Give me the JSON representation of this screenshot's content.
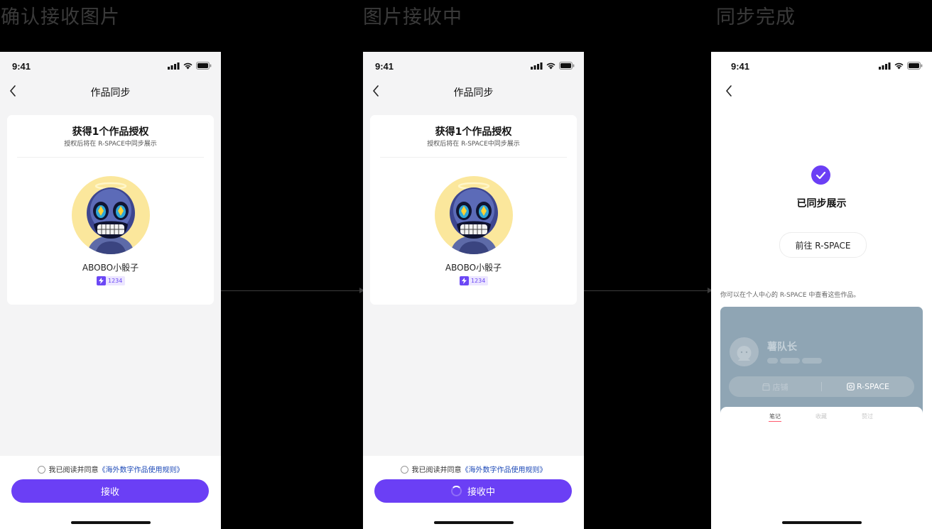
{
  "flow": {
    "step1_title": "确认接收图片",
    "step2_title": "图片接收中",
    "step3_title": "同步完成"
  },
  "status_bar": {
    "time": "9:41"
  },
  "screen_receive": {
    "nav_title": "作品同步",
    "card_title": "获得1个作品授权",
    "card_subtitle": "授权后将在 R-SPACE中同步展示",
    "artwork_name": "ABOBO小骰子",
    "artwork_number": "1234",
    "agree_prefix": "我已阅读并同意",
    "agree_link": "《海外数字作品使用规则》",
    "button_label": "接收"
  },
  "screen_receiving": {
    "nav_title": "作品同步",
    "card_title": "获得1个作品授权",
    "card_subtitle": "授权后将在 R-SPACE中同步展示",
    "artwork_name": "ABOBO小骰子",
    "artwork_number": "1234",
    "agree_prefix": "我已阅读并同意",
    "agree_link": "《海外数字作品使用规则》",
    "button_label": "接收中"
  },
  "screen_done": {
    "done_text": "已同步展示",
    "goto_button": "前往 R-SPACE",
    "hint": "你可以在个人中心的 R-SPACE 中查看这些作品。",
    "preview": {
      "profile_name": "薯队长",
      "shop_label": "店铺",
      "rspace_label": "R-SPACE",
      "tabs": [
        "笔记",
        "收藏",
        "赞过"
      ]
    }
  },
  "colors": {
    "accent": "#6b3ff5",
    "link": "#1e4ab8",
    "background": "#000000"
  }
}
